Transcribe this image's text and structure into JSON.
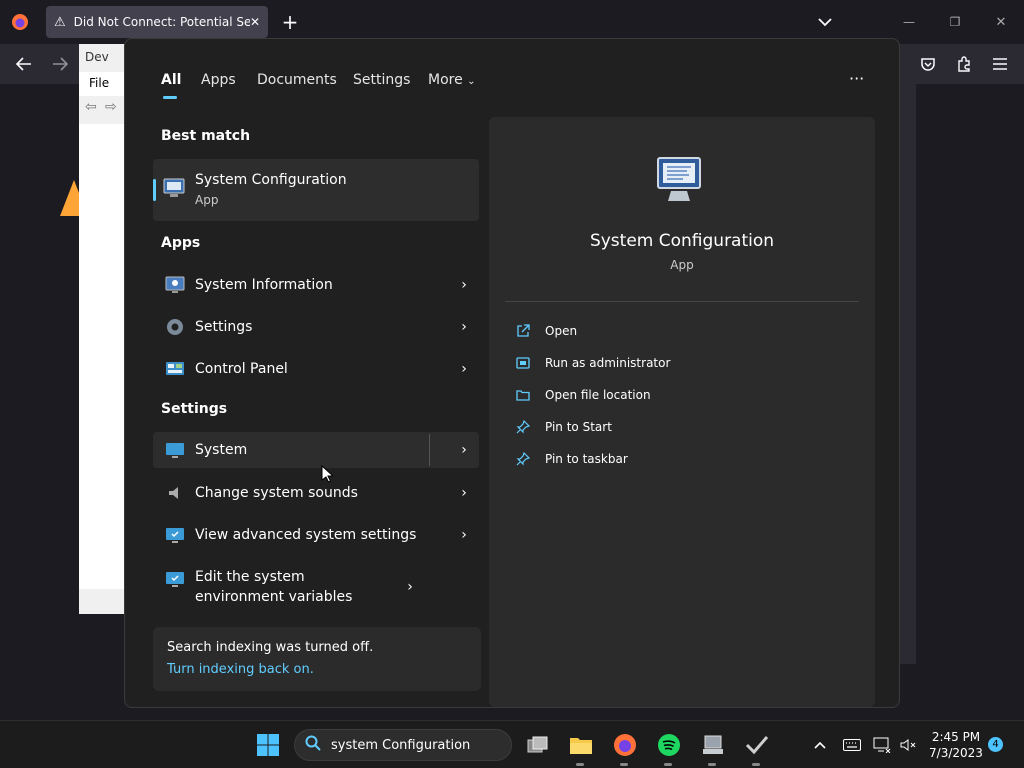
{
  "browser": {
    "tab_title": "Did Not Connect: Potential Security Issue",
    "new_tab": "+",
    "window_controls": {
      "minimize": "—",
      "restore": "❐",
      "close": "✕"
    }
  },
  "devmgr": {
    "title_partial": "Dev",
    "menu_file": "File"
  },
  "search": {
    "tabs": [
      {
        "label": "All"
      },
      {
        "label": "Apps"
      },
      {
        "label": "Documents"
      },
      {
        "label": "Settings"
      },
      {
        "label": "More"
      }
    ],
    "more_options": "···",
    "best_match_heading": "Best match",
    "best_match": {
      "name": "System Configuration",
      "type": "App"
    },
    "apps_heading": "Apps",
    "apps": [
      {
        "label": "System Information"
      },
      {
        "label": "Settings"
      },
      {
        "label": "Control Panel"
      }
    ],
    "settings_heading": "Settings",
    "settings": [
      {
        "label": "System"
      },
      {
        "label": "Change system sounds"
      },
      {
        "label": "View advanced system settings"
      },
      {
        "label": "Edit the system environment variables"
      }
    ],
    "index_notice": "Search indexing was turned off.",
    "index_link": "Turn indexing back on.",
    "detail": {
      "name": "System Configuration",
      "type": "App",
      "actions": [
        {
          "label": "Open",
          "icon": "open-icon"
        },
        {
          "label": "Run as administrator",
          "icon": "admin-icon"
        },
        {
          "label": "Open file location",
          "icon": "folder-icon"
        },
        {
          "label": "Pin to Start",
          "icon": "pin-icon"
        },
        {
          "label": "Pin to taskbar",
          "icon": "pin-icon"
        }
      ]
    }
  },
  "taskbar": {
    "search_value": "system Configuration",
    "time": "2:45 PM",
    "date": "7/3/2023",
    "notification_count": "4"
  },
  "colors": {
    "accent": "#60cdff",
    "bg": "#202020",
    "pane": "#2b2b2b",
    "taskbar": "#1c1c1c"
  }
}
